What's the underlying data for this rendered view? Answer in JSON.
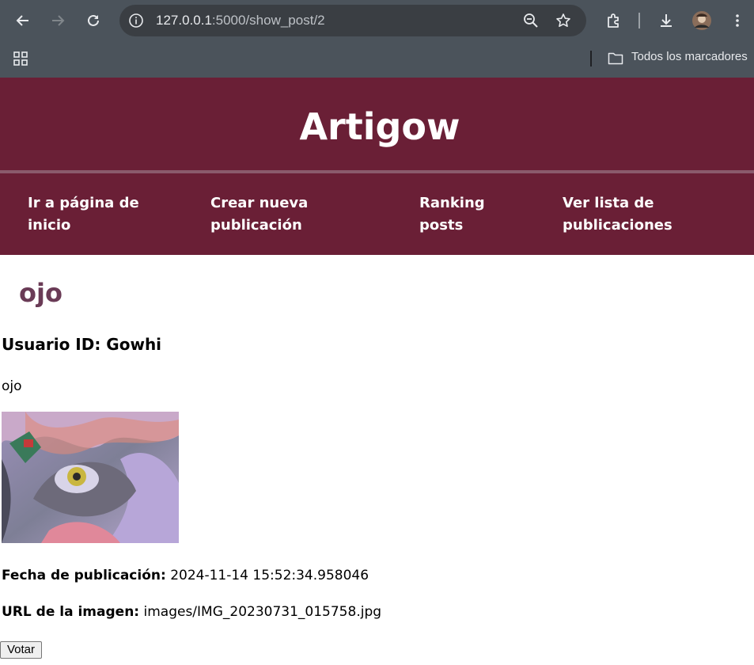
{
  "browser": {
    "url_host": "127.0.0.1",
    "url_path": ":5000/show_post/2",
    "bookmarks_label": "Todos los marcadores",
    "icons": [
      "back-arrow-icon",
      "forward-arrow-icon",
      "reload-icon",
      "site-info-icon",
      "zoom-out-icon",
      "star-bookmark-icon",
      "extensions-icon",
      "download-icon",
      "profile-avatar",
      "kebab-menu-icon",
      "apps-grid-icon",
      "folder-icon"
    ]
  },
  "site": {
    "title": "Artigow",
    "nav": [
      {
        "label": "Ir a página de inicio"
      },
      {
        "label": "Crear nueva publicación"
      },
      {
        "label": "Ranking posts"
      },
      {
        "label": "Ver lista de publicaciones"
      }
    ],
    "colors": {
      "header": "#6a1f36",
      "post_title": "#6a3b56"
    }
  },
  "post": {
    "title": "ojo",
    "user_label": "Usuario ID: Gowhi",
    "body": "ojo",
    "image_alt": "drawing of an eye",
    "date_label": "Fecha de publicación:",
    "date_value": "2024-11-14 15:52:34.958046",
    "url_label": "URL de la imagen:",
    "url_value": "images/IMG_20230731_015758.jpg",
    "vote_label": "Votar"
  }
}
